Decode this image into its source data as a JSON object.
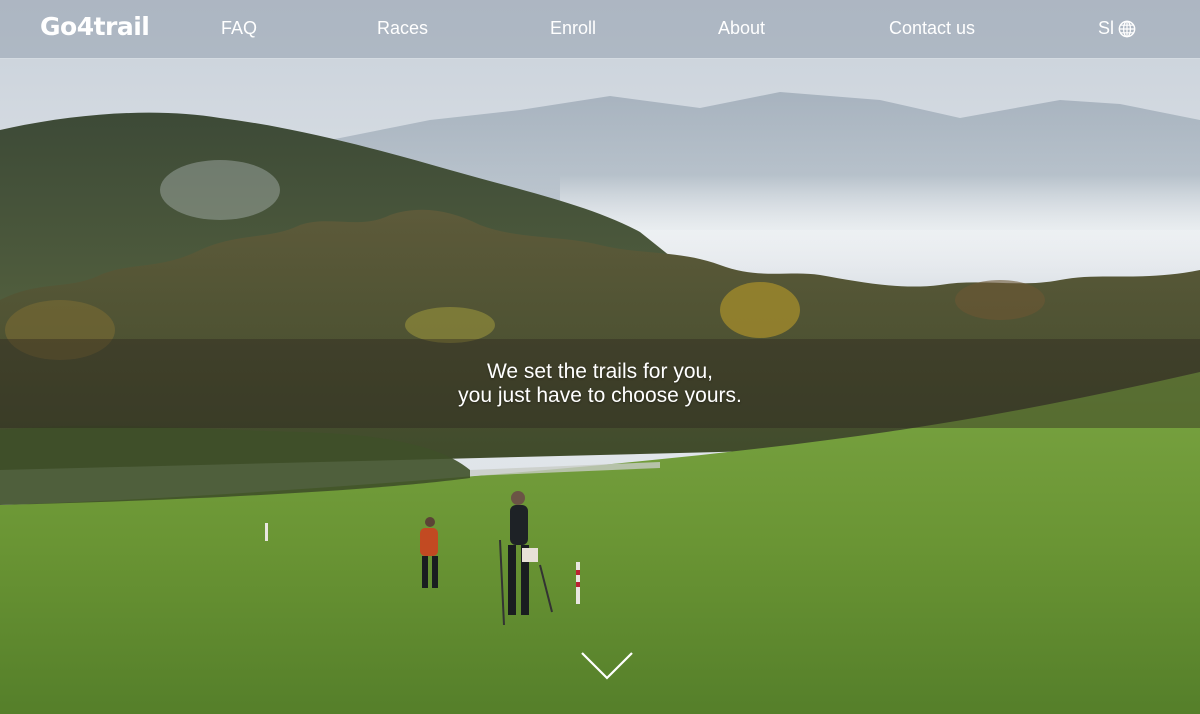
{
  "brand": {
    "logo_text": "Go4trail"
  },
  "nav": {
    "items": [
      {
        "label": "FAQ"
      },
      {
        "label": "Races"
      },
      {
        "label": "Enroll"
      },
      {
        "label": "About"
      },
      {
        "label": "Contact us"
      }
    ],
    "language": {
      "label": "Sl",
      "icon": "globe-icon"
    }
  },
  "hero": {
    "tagline_line1": "We set the trails for you,",
    "tagline_line2": "you just have to choose yours.",
    "scroll_icon": "chevron-down-icon"
  },
  "colors": {
    "navbar_bg": "#969faf",
    "text": "#ffffff",
    "grass": "#6f9b3a",
    "forest": "#4a5a33",
    "sky": "#dfe5ea"
  }
}
